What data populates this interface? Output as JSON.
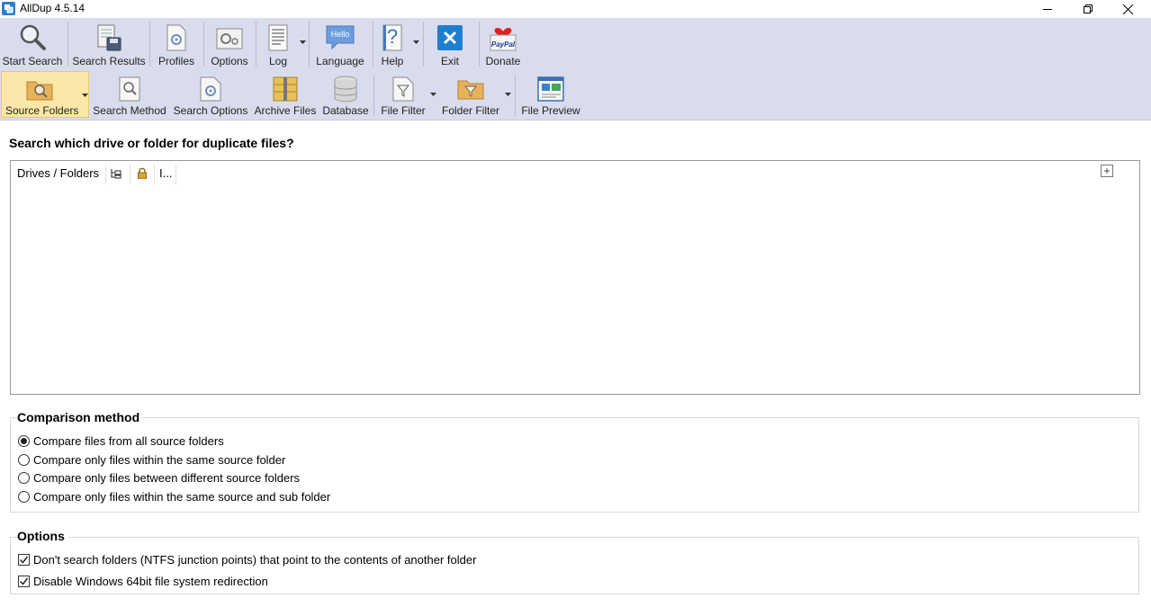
{
  "window": {
    "title": "AllDup 4.5.14",
    "controls": [
      "minimize",
      "restore",
      "close"
    ]
  },
  "toolbar_top": [
    {
      "label": "Start Search",
      "icon": "magnifier-icon"
    },
    {
      "label": "Search Results",
      "icon": "search-results-icon"
    },
    {
      "label": "Profiles",
      "icon": "profiles-icon"
    },
    {
      "label": "Options",
      "icon": "options-icon"
    },
    {
      "label": "Log",
      "icon": "log-icon"
    },
    {
      "label": "Language",
      "icon": "language-icon",
      "icon_text": "Hello"
    },
    {
      "label": "Help",
      "icon": "help-icon",
      "icon_text": "?"
    },
    {
      "label": "Exit",
      "icon": "exit-icon"
    },
    {
      "label": "Donate",
      "icon": "paypal-icon",
      "icon_text": "PayPal"
    }
  ],
  "toolbar_bottom": [
    {
      "label": "Source Folders",
      "icon": "source-folders-icon",
      "active": true
    },
    {
      "label": "Search Method",
      "icon": "search-method-icon"
    },
    {
      "label": "Search Options",
      "icon": "search-options-icon"
    },
    {
      "label": "Archive Files",
      "icon": "archive-files-icon"
    },
    {
      "label": "Database",
      "icon": "database-icon"
    },
    {
      "label": "File Filter",
      "icon": "file-filter-icon"
    },
    {
      "label": "Folder Filter",
      "icon": "folder-filter-icon"
    },
    {
      "label": "File Preview",
      "icon": "file-preview-icon"
    }
  ],
  "main": {
    "heading": "Search which drive or folder for duplicate files?",
    "folder_list": {
      "columns": [
        "Drives / Folders",
        "",
        "",
        "I..."
      ],
      "add_button": "+"
    }
  },
  "comparison": {
    "title": "Comparison method",
    "options": [
      {
        "label": "Compare files from all source folders",
        "selected": true
      },
      {
        "label": "Compare only files within the same source folder",
        "selected": false
      },
      {
        "label": "Compare only files between different source folders",
        "selected": false
      },
      {
        "label": "Compare only files within the same source and sub folder",
        "selected": false
      }
    ]
  },
  "options": {
    "title": "Options",
    "items": [
      {
        "label": "Don't search folders (NTFS junction points) that point to the contents of another folder",
        "checked": true
      },
      {
        "label": "Disable Windows 64bit file system redirection",
        "checked": true
      }
    ]
  }
}
